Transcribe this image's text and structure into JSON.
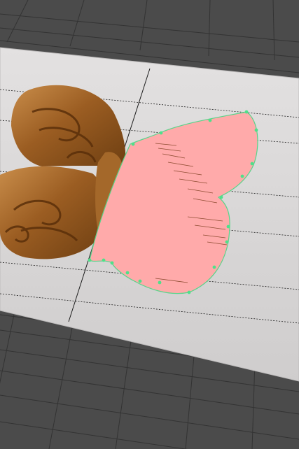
{
  "viewport": {
    "label": ""
  },
  "colors": {
    "background": "#4b4b4b",
    "grid_line": "#2e2e2e",
    "grid_line_light": "#5a5a5a",
    "plane": "#dcdada",
    "plane_edge": "#c8c6c6",
    "wood_dark": "#6e3f12",
    "wood_mid": "#9b5d22",
    "wood_light": "#c98d4a",
    "mask_fill": "#ffaaaa",
    "mask_stroke": "#e08a8a",
    "control_point": "#4fe08a",
    "mask_edge": "#58d58a",
    "hatch": "#7a3b1c"
  },
  "objects": [
    {
      "name": "butterfly-carving",
      "kind": "image-reference"
    },
    {
      "name": "selection-mask",
      "kind": "polygon-mask"
    }
  ],
  "icons": {
    "control_point": "circle-handle-icon"
  }
}
